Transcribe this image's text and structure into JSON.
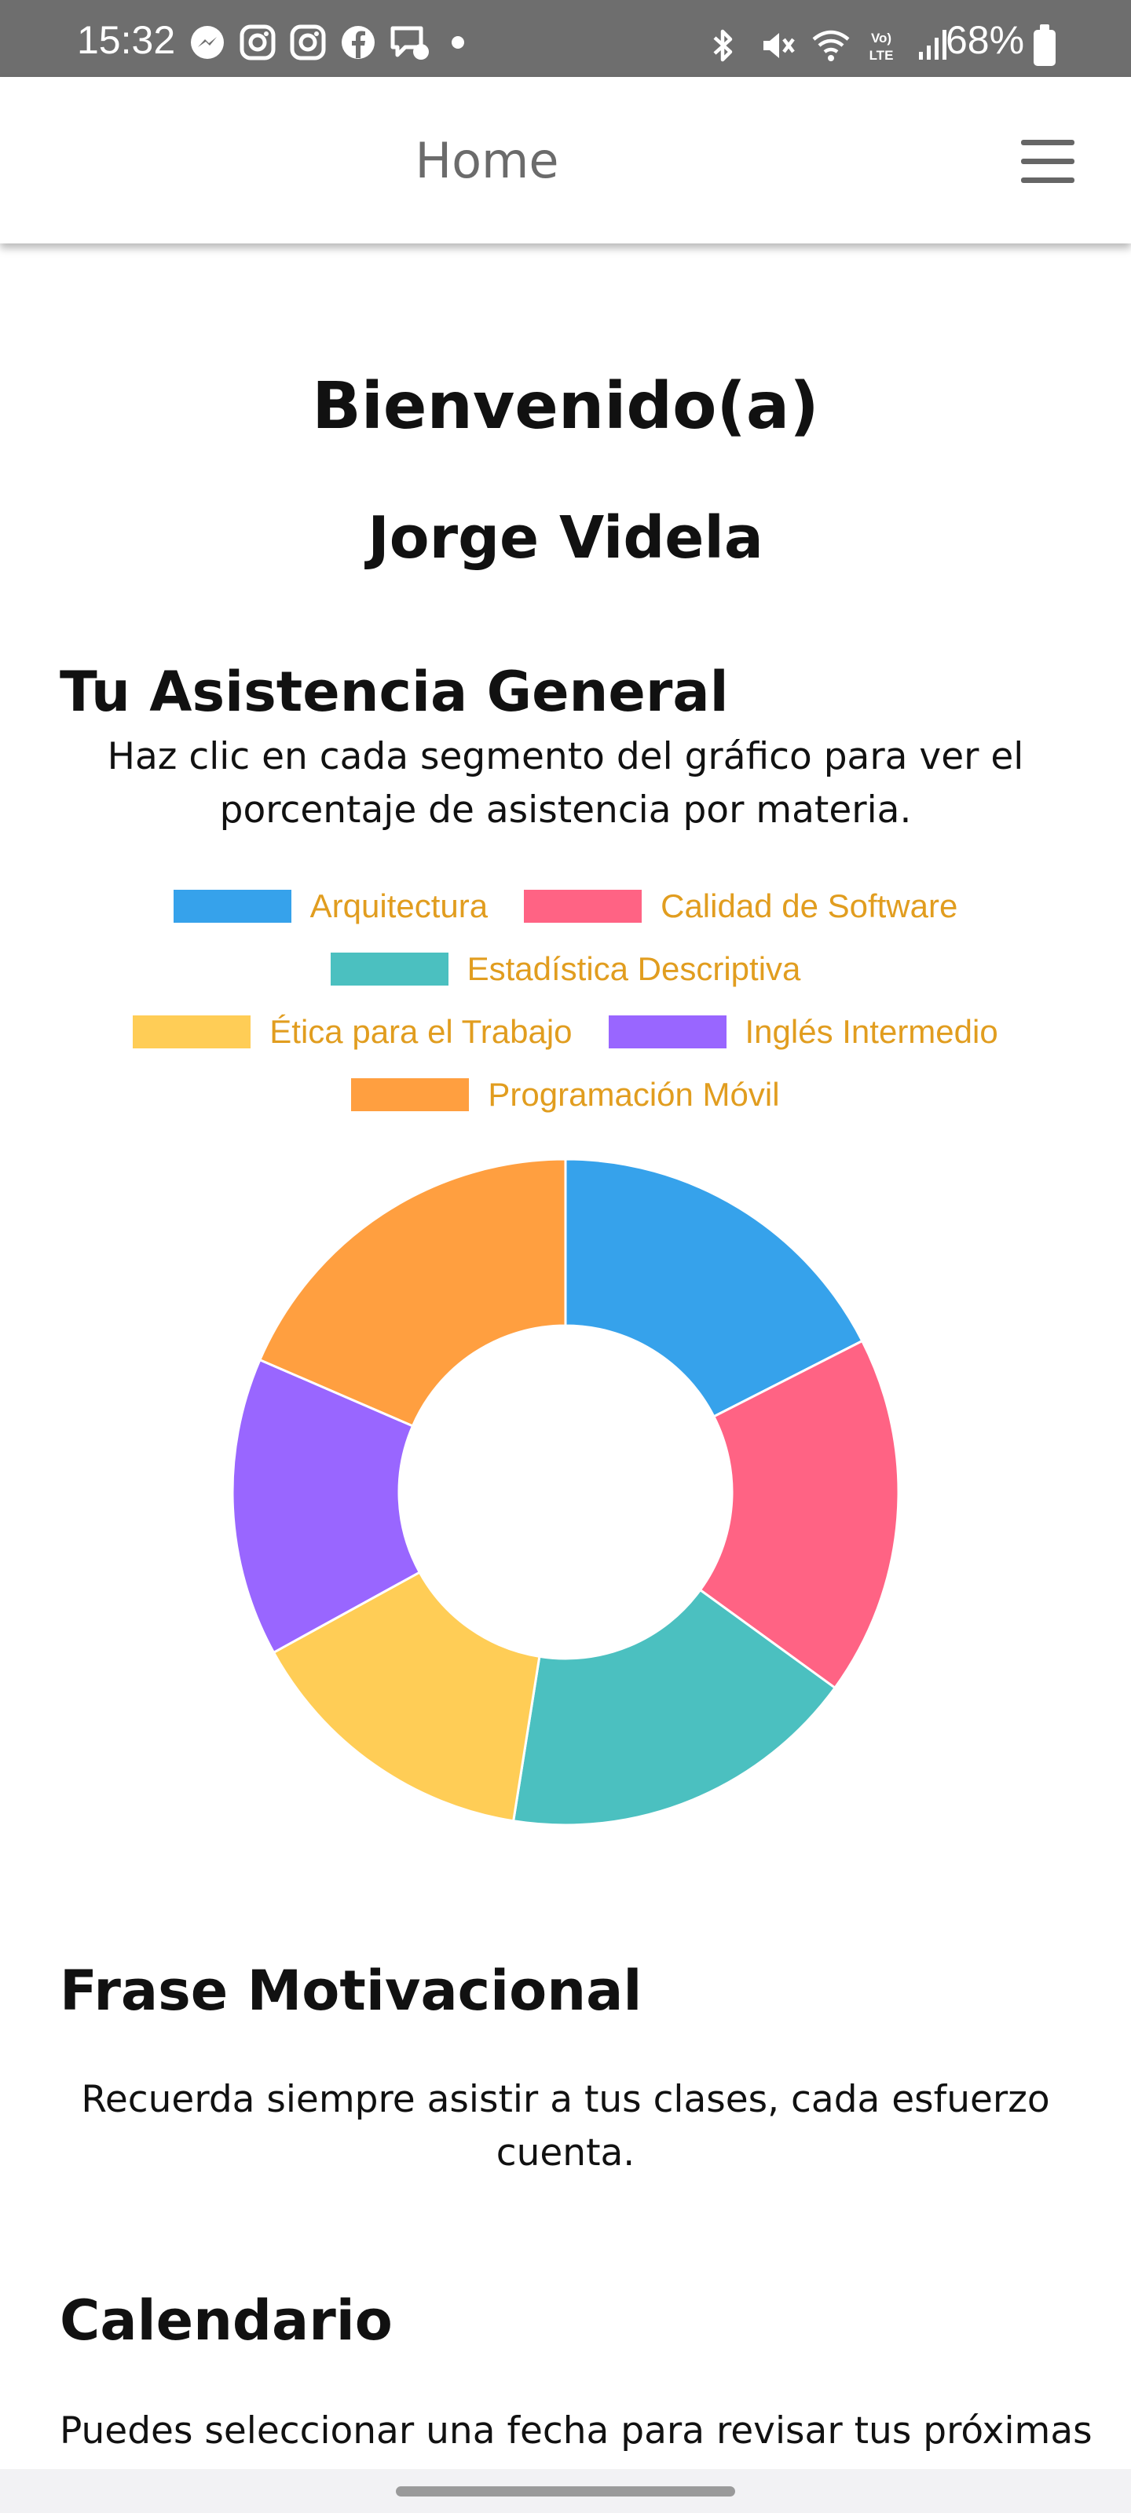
{
  "status_bar": {
    "time": "15:32",
    "battery": "68%",
    "left_icons": [
      "messenger-icon",
      "instagram-icon",
      "instagram-icon",
      "facebook-icon",
      "chat-icon"
    ],
    "right_icons": [
      "bluetooth-icon",
      "mute-icon",
      "wifi-icon",
      "volte-icon",
      "signal-icon"
    ]
  },
  "app_bar": {
    "title": "Home",
    "menu_icon": "hamburger-menu-icon"
  },
  "welcome": {
    "greeting": "Bienvenido(a)",
    "name": "Jorge Videla"
  },
  "attendance": {
    "title": "Tu Asistencia General",
    "instructions": "Haz clic en cada segmento del gráfico para ver el porcentaje de asistencia por materia."
  },
  "chart_data": {
    "type": "pie",
    "categories": [
      "Arquitectura",
      "Calidad de Software",
      "Estadística Descriptiva",
      "Ética para el Trabajo",
      "Inglés Intermedio",
      "Programación Móvil"
    ],
    "values": [
      17.5,
      17.5,
      17.5,
      14.5,
      14.5,
      18.5
    ],
    "colors": [
      "#36a2eb",
      "#ff6384",
      "#4bc0c0",
      "#ffcd56",
      "#9966ff",
      "#ff9f40"
    ],
    "legend_position": "top",
    "legend_text_color": "#e19d1f",
    "donut": true
  },
  "motivation": {
    "title": "Frase Motivacional",
    "text": "Recuerda siempre asistir a tus clases, cada esfuerzo cuenta."
  },
  "calendar": {
    "title": "Calendario",
    "text": "Puedes seleccionar una fecha para revisar tus próximas"
  }
}
